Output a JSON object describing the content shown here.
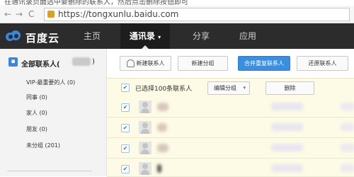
{
  "top_strip": {
    "text": "在通讯录页面选中要删除的联系人，然后点击删除按钮即可"
  },
  "browser": {
    "back_icon": "back-arrow-icon",
    "forward_icon": "forward-arrow-icon",
    "reload_icon": "reload-icon",
    "back": "←",
    "forward": "→",
    "reload": "C",
    "url": "https://tongxunlu.baidu.com",
    "secure": true
  },
  "app": {
    "logo_text": "百度云",
    "brand_color": "#3b86d6",
    "nav": [
      {
        "label": "主页",
        "active": false
      },
      {
        "label": "通讯录",
        "active": true,
        "caret": "▾"
      },
      {
        "label": "分享",
        "active": false
      },
      {
        "label": "应用",
        "active": false
      }
    ]
  },
  "sidebar": {
    "all_contacts_label": "全部联系人(",
    "all_contacts_close": ")",
    "items": [
      {
        "label": "VIP-最重要的人 (0)"
      },
      {
        "label": "同事 (0)"
      },
      {
        "label": "家人 (0)"
      },
      {
        "label": "朋友 (0)"
      },
      {
        "label": "未分组 (201)"
      }
    ]
  },
  "toolbar": {
    "new_contact": "新建联系人",
    "new_group": "新建分组",
    "merge_duplicates": "合并重复联系人",
    "restore_contacts": "还原联系人",
    "person_icon": "add-person-icon"
  },
  "selection": {
    "checkmark": "✔",
    "label": "已选择100条联系人",
    "edit_group": "编辑分组",
    "edit_group_caret": "▾",
    "delete": "删除"
  },
  "colors": {
    "header_bg": "#2c2c2c",
    "primary_button": "#3a8fe0",
    "row_bg": "#fdfbe6"
  }
}
